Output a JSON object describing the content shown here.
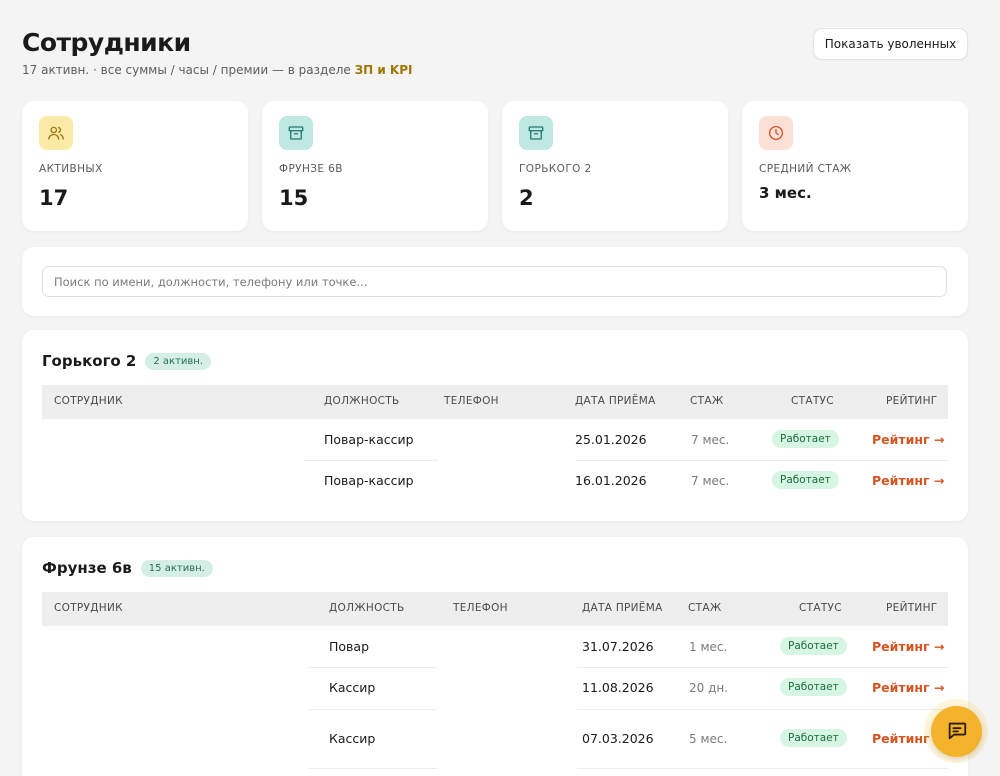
{
  "header": {
    "title": "Сотрудники",
    "subtitle_prefix": "17 активн. · все суммы / часы / премии — в разделе ",
    "subtitle_link": "ЗП и KPI",
    "show_fired_label": "Показать уволенных"
  },
  "stats": [
    {
      "label": "АКТИВНЫХ",
      "value": "17",
      "icon": "users-icon",
      "color": "#fbeaa6"
    },
    {
      "label": "ФРУНЗЕ 6В",
      "value": "15",
      "icon": "store-icon",
      "color": "#bfe8e2"
    },
    {
      "label": "ГОРЬКОГО 2",
      "value": "2",
      "icon": "store-icon",
      "color": "#bfe8e2"
    },
    {
      "label": "СРЕДНИЙ СТАЖ",
      "value": "3 мес.",
      "icon": "clock-icon",
      "color": "#fbe0d6"
    }
  ],
  "search": {
    "placeholder": "Поиск по имени, должности, телефону или точке..."
  },
  "columns": {
    "employee": "СОТРУДНИК",
    "position": "ДОЛЖНОСТЬ",
    "phone": "ТЕЛЕФОН",
    "hire_date": "ДАТА ПРИЁМА",
    "tenure": "СТАЖ",
    "status": "СТАТУС",
    "rating": "РЕЙТИНГ"
  },
  "groups": [
    {
      "name": "Горького 2",
      "badge": "2 активн.",
      "rows": [
        {
          "position": "Повар-кассир",
          "hire_date": "25.01.2026",
          "tenure": "7 мес.",
          "status": "Работает",
          "rating": "Рейтинг →"
        },
        {
          "position": "Повар-кассир",
          "hire_date": "16.01.2026",
          "tenure": "7 мес.",
          "status": "Работает",
          "rating": "Рейтинг →"
        }
      ]
    },
    {
      "name": "Фрунзе 6в",
      "badge": "15 активн.",
      "rows": [
        {
          "position": "Повар",
          "hire_date": "31.07.2026",
          "tenure": "1 мес.",
          "status": "Работает",
          "rating": "Рейтинг →"
        },
        {
          "position": "Кассир",
          "hire_date": "11.08.2026",
          "tenure": "20 дн.",
          "status": "Работает",
          "rating": "Рейтинг →"
        },
        {
          "position": "Кассир",
          "hire_date": "07.03.2026",
          "tenure": "5 мес.",
          "status": "Работает",
          "rating": "Рейтинг →"
        }
      ]
    }
  ],
  "fab": {
    "icon": "chat-icon"
  }
}
